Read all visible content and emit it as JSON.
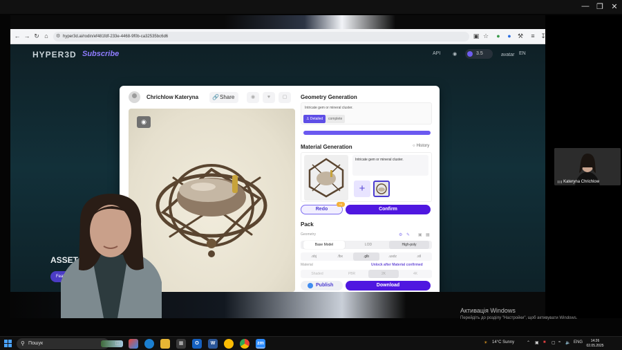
{
  "window": {
    "minimize": "—",
    "restore": "❐",
    "close": "✕"
  },
  "browser": {
    "url": "hyper3d.ai/rodin/ef481fdf-233e-4468-9f0b-ca32535bc6d6"
  },
  "site": {
    "logo": "HYPER3D",
    "subscribe": "Subscribe",
    "api": "API",
    "credits": "3.5",
    "avatar_alt": "avatar",
    "lang": "EN",
    "asset_label": "ASSET",
    "asset_button": "Featu"
  },
  "modal": {
    "username": "Chrichlow Kateryna",
    "share": "Share",
    "geometry": {
      "title": "Geometry Generation",
      "prompt": "Intricate gem or mineral cluster.",
      "chip_detailed": "⚓ Detailed",
      "chip_complete": "complete"
    },
    "material": {
      "title": "Material Generation",
      "history": "History",
      "prompt": "Intricate gem or mineral cluster.",
      "plus": "+"
    },
    "redo": "Redo",
    "redo_badge": "+0",
    "confirm": "Confirm",
    "pack": {
      "title": "Pack",
      "geometry_label": "Geometry",
      "modes": [
        "Base Model",
        "LOD",
        "High-poly"
      ],
      "formats": [
        ".obj",
        ".fbx",
        ".glb",
        ".usdz",
        ".stl"
      ],
      "material_label": "Material",
      "unlock": "Unlock after Material confirmed",
      "materials": [
        "Shaded",
        "PBR",
        "2K",
        "4K"
      ]
    },
    "publish": "Publish",
    "download": "Download"
  },
  "zoom": {
    "participant": "Kateryna Chrichlow"
  },
  "windows_notice": {
    "title": "Активація Windows",
    "subtitle": "Перейдіть до розділу \"Настройки\", щоб активувати Windows."
  },
  "taskbar": {
    "search": "Пошук",
    "weather": "14°C  Sunny",
    "lang": "ENG",
    "time": "14:26",
    "date": "02.05.2025"
  }
}
